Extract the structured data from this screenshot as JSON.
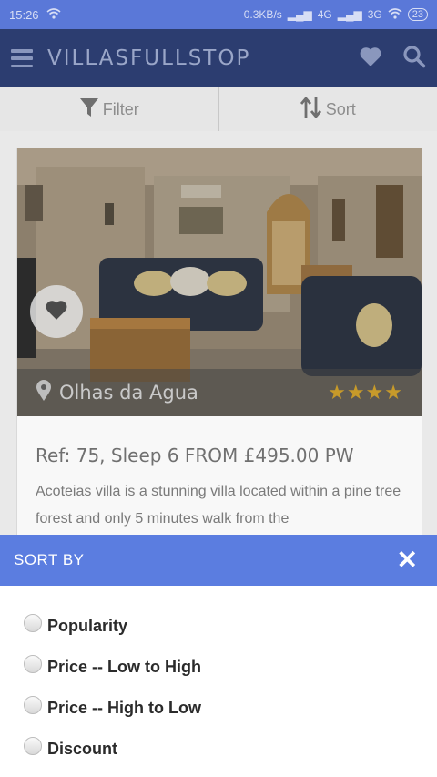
{
  "status_bar": {
    "time": "15:26",
    "network": "0.3KB/s",
    "signal_1": "4G",
    "signal_2": "3G",
    "battery": "23"
  },
  "app_bar": {
    "title": "VILLASFULLSTOP",
    "icons": [
      "menu-icon",
      "heart-icon",
      "search-icon"
    ]
  },
  "toolbar": {
    "filter_label": "Filter",
    "sort_label": "Sort"
  },
  "listing": {
    "location": "Olhas da Agua",
    "rating": 4,
    "rating_stars": "★★★★",
    "ref": "Ref: 75, Sleep 6 FROM £495.00 PW",
    "description": "Acoteias villa is a stunning villa located within a pine tree forest and only 5 minutes walk from the"
  },
  "sort_sheet": {
    "title": "SORT BY",
    "options": [
      "Popularity",
      "Price -- Low to High",
      "Price -- High to Low",
      "Discount"
    ]
  },
  "colors": {
    "app_bar": "#2c3d70",
    "sheet_header": "#5b7de0",
    "star": "#c79a2a"
  }
}
